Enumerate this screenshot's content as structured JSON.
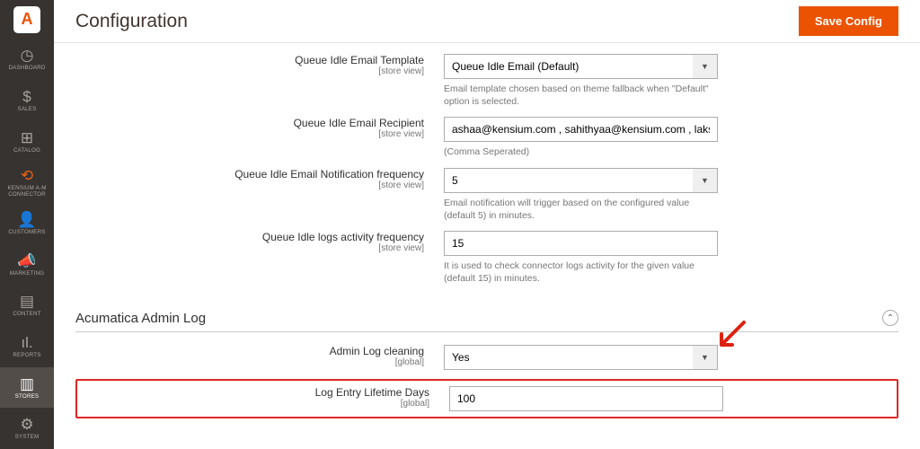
{
  "title": "Configuration",
  "save": "Save Config",
  "logo": "A",
  "menu": [
    {
      "label": "Dashboard",
      "icon": "◷"
    },
    {
      "label": "Sales",
      "icon": "$"
    },
    {
      "label": "Catalog",
      "icon": "⊞"
    },
    {
      "label": "Kensium A-M Connector",
      "icon": "⟲"
    },
    {
      "label": "Customers",
      "icon": "👤"
    },
    {
      "label": "Marketing",
      "icon": "📣"
    },
    {
      "label": "Content",
      "icon": "▤"
    },
    {
      "label": "Reports",
      "icon": "ıl."
    },
    {
      "label": "Stores",
      "icon": "▥"
    },
    {
      "label": "System",
      "icon": "⚙"
    }
  ],
  "sec_title": "Acumatica Admin Log",
  "f": {
    "tmpl": {
      "label": "Queue Idle Email Template",
      "scope": "[store view]",
      "value": "Queue Idle Email (Default)",
      "help": "Email template chosen based on theme fallback when \"Default\" option is selected."
    },
    "rcpt": {
      "label": "Queue Idle Email Recipient",
      "scope": "[store view]",
      "value": "ashaa@kensium.com , sahithyaa@kensium.com , lakshmip@ke",
      "help": "(Comma Seperated)"
    },
    "freq": {
      "label": "Queue Idle Email Notification frequency",
      "scope": "[store view]",
      "value": "5",
      "help": "Email notification will trigger based on the configured value (default 5) in minutes."
    },
    "logf": {
      "label": "Queue Idle logs activity frequency",
      "scope": "[store view]",
      "value": "15",
      "help": "It is used to check connector logs activity for the given value (default 15) in minutes."
    },
    "clean": {
      "label": "Admin Log cleaning",
      "scope": "[global]",
      "value": "Yes"
    },
    "life": {
      "label": "Log Entry Lifetime Days",
      "scope": "[global]",
      "value": "100"
    }
  }
}
